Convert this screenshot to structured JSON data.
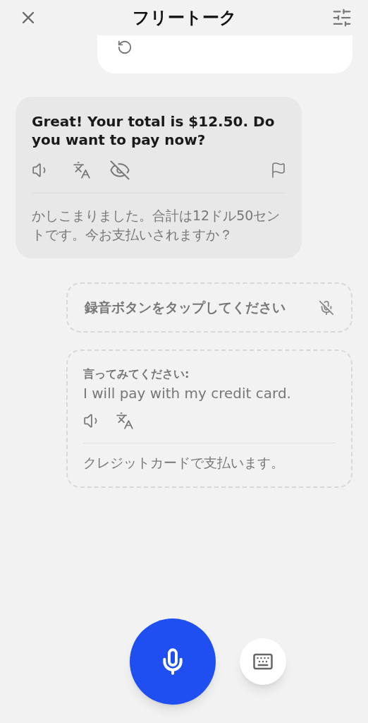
{
  "header": {
    "title": "フリートーク"
  },
  "messages": [
    {
      "kind": "user_partial"
    },
    {
      "kind": "bot",
      "text": "Great! Your total is $12.50. Do you want to pay now?",
      "translation": "かしこまりました。合計は12ドル50セントです。今お支払いされますか？"
    },
    {
      "kind": "prompt",
      "text": "録音ボタンをタップしてください"
    },
    {
      "kind": "suggestion",
      "label": "言ってみてください:",
      "text": "I will pay with my credit card.",
      "translation": "クレジットカードで支払います。"
    }
  ]
}
